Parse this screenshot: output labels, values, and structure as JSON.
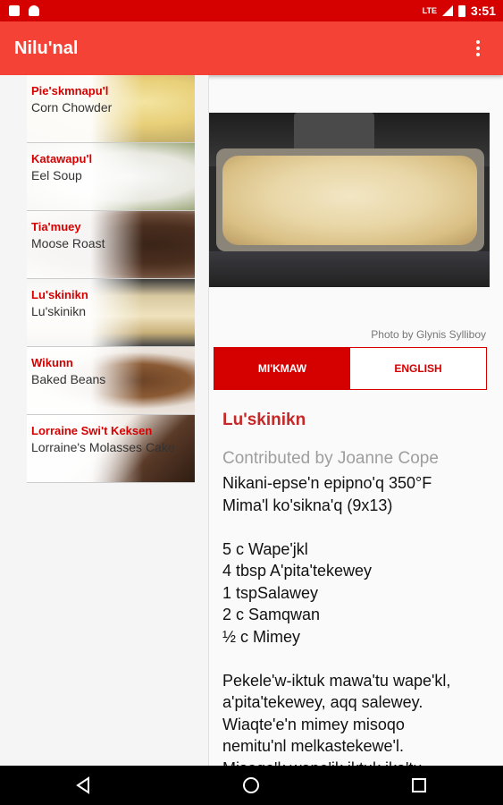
{
  "status_bar": {
    "time": "3:51",
    "network": "LTE"
  },
  "app_bar": {
    "title": "Nilu'nal",
    "menu_icon": "overflow-menu-icon"
  },
  "recipes": [
    {
      "mikmaw": "Pie'skmnapu'l",
      "english": "Corn Chowder"
    },
    {
      "mikmaw": "Katawapu'l",
      "english": "Eel Soup"
    },
    {
      "mikmaw": "Tia'muey",
      "english": "Moose Roast"
    },
    {
      "mikmaw": "Lu'skinikn",
      "english": "Lu'skinikn"
    },
    {
      "mikmaw": "Wikunn",
      "english": "Baked Beans"
    },
    {
      "mikmaw": "Lorraine Swi't Keksen",
      "english": "Lorraine's Molasses Cake"
    }
  ],
  "detail": {
    "photo_credit": "Photo by Glynis Sylliboy",
    "tabs": {
      "mikmaw": "MI'KMAW",
      "english": "ENGLISH"
    },
    "title": "Lu'skinikn",
    "contributor": "Contributed by Joanne Cope",
    "lines": [
      "Nikani-epse'n epipno'q 350°F",
      "Mima'l ko'sikna'q (9x13)",
      "",
      "5 c  Wape'jkl",
      "4 tbsp  A'pita'tekewey",
      "1 tspSalawey",
      "2 c  Samqwan",
      "½ c   Mimey",
      "",
      "Pekele'w-iktuk mawa'tu wape'kl,",
      "a'pita'tekewey, aqq salewey.",
      "Wiaqte'e'n mimey misoqo",
      "nemitu'nl melkastekewe'l.",
      "Misoqo'k wape'jk iktuk ika'tu"
    ]
  }
}
